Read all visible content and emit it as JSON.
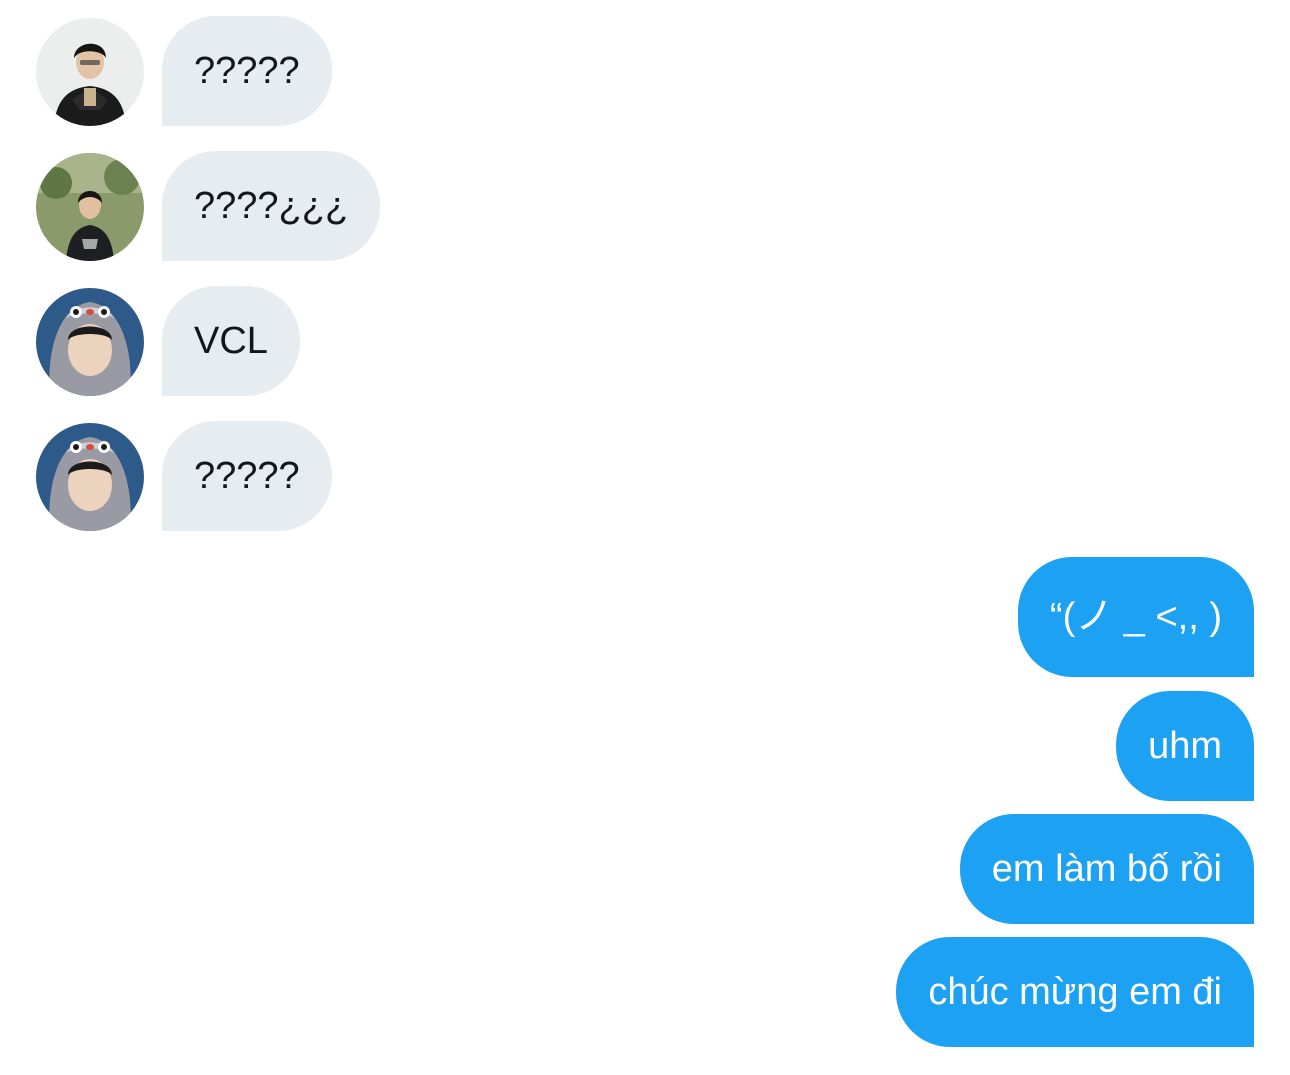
{
  "incoming": [
    {
      "text": "?????",
      "avatar": "avatar-player-black-jacket"
    },
    {
      "text": "????¿¿¿",
      "avatar": "avatar-player-outdoor"
    },
    {
      "text": "VCL",
      "avatar": "avatar-hooded-player"
    },
    {
      "text": "?????",
      "avatar": "avatar-hooded-player"
    }
  ],
  "outgoing": [
    {
      "text": "“(ノ _ <,, )"
    },
    {
      "text": "uhm"
    },
    {
      "text": "em làm bố rồi"
    },
    {
      "text": "chúc mừng em đi"
    }
  ],
  "colors": {
    "incoming_bubble": "#e6ecf0",
    "outgoing_bubble": "#1da1f2",
    "incoming_text": "#14171a",
    "outgoing_text": "#ffffff"
  }
}
